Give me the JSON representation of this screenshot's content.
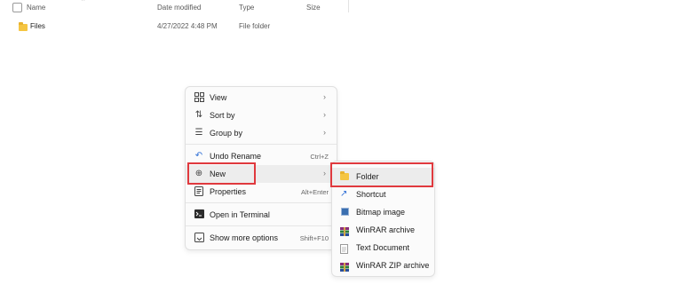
{
  "columns": {
    "name": "Name",
    "date_modified": "Date modified",
    "type": "Type",
    "size": "Size"
  },
  "file_row": {
    "name": "Files",
    "date_modified": "4/27/2022 4:48 PM",
    "type": "File folder"
  },
  "context_menu": {
    "items": [
      {
        "label": "View",
        "icon": "grid-view-icon",
        "has_submenu": true
      },
      {
        "label": "Sort by",
        "icon": "sort-icon",
        "has_submenu": true
      },
      {
        "label": "Group by",
        "icon": "group-icon",
        "has_submenu": true
      },
      {
        "label": "Undo Rename",
        "icon": "undo-icon",
        "shortcut": "Ctrl+Z"
      },
      {
        "label": "New",
        "icon": "new-plus-icon",
        "has_submenu": true,
        "highlighted": true
      },
      {
        "label": "Properties",
        "icon": "properties-icon",
        "shortcut": "Alt+Enter"
      },
      {
        "label": "Open in Terminal",
        "icon": "terminal-icon"
      },
      {
        "label": "Show more options",
        "icon": "more-options-icon",
        "shortcut": "Shift+F10"
      }
    ]
  },
  "new_submenu": {
    "items": [
      {
        "label": "Folder",
        "icon": "folder-icon",
        "highlighted": true
      },
      {
        "label": "Shortcut",
        "icon": "shortcut-icon"
      },
      {
        "label": "Bitmap image",
        "icon": "bitmap-icon"
      },
      {
        "label": "WinRAR archive",
        "icon": "winrar-icon"
      },
      {
        "label": "Text Document",
        "icon": "text-document-icon"
      },
      {
        "label": "WinRAR ZIP archive",
        "icon": "winrar-zip-icon"
      }
    ]
  },
  "colors": {
    "highlight_box": "#e0393e",
    "folder": "#f5c542"
  }
}
